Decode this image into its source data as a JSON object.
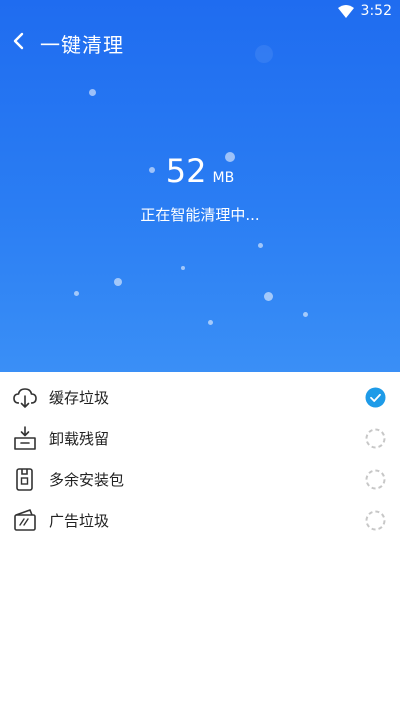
{
  "status_bar": {
    "time": "3:52",
    "wifi_icon": "wifi-icon"
  },
  "header": {
    "title": "一键清理",
    "back_icon": "chevron-left-icon"
  },
  "progress": {
    "size_value": "52",
    "size_unit": "MB",
    "status_text": "正在智能清理中..."
  },
  "colors": {
    "hero_top": "#1f6cf0",
    "hero_bottom": "#3a8ff6",
    "check": "#1e9be8"
  },
  "items": [
    {
      "label": "缓存垃圾",
      "icon": "cloud-download-icon",
      "state": "done"
    },
    {
      "label": "卸载残留",
      "icon": "uninstall-box-icon",
      "state": "scanning"
    },
    {
      "label": "多余安装包",
      "icon": "package-icon",
      "state": "scanning"
    },
    {
      "label": "广告垃圾",
      "icon": "ad-card-icon",
      "state": "scanning"
    }
  ]
}
